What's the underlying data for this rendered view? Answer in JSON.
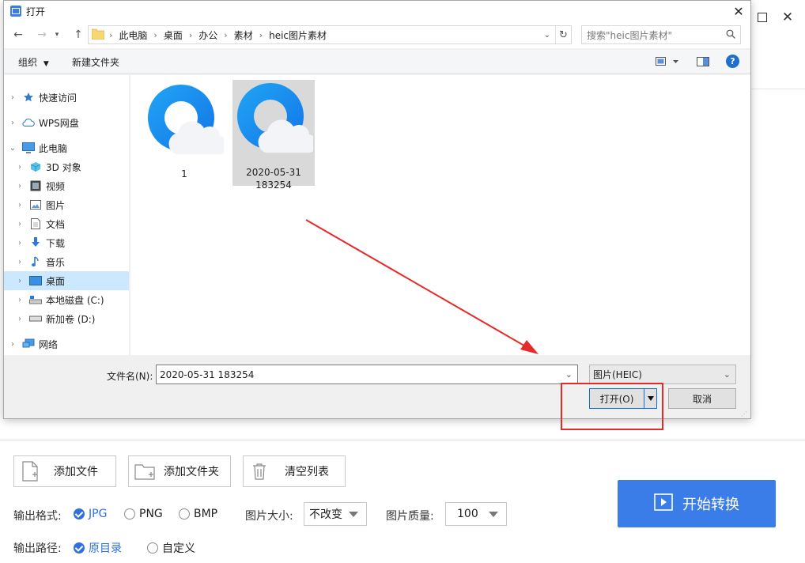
{
  "dialog": {
    "title": "打开",
    "breadcrumbs": [
      "此电脑",
      "桌面",
      "办公",
      "素材",
      "heic图片素材"
    ],
    "search_placeholder": "搜索\"heic图片素材\"",
    "toolbar": {
      "organize": "组织",
      "new_folder": "新建文件夹"
    },
    "nav": [
      {
        "label": "快速访问",
        "icon": "star-icon"
      },
      {
        "label": "WPS网盘",
        "icon": "cloud-icon"
      },
      {
        "label": "此电脑",
        "icon": "computer-icon"
      },
      {
        "label": "3D 对象",
        "icon": "cube-icon"
      },
      {
        "label": "视频",
        "icon": "film-icon"
      },
      {
        "label": "图片",
        "icon": "image-icon"
      },
      {
        "label": "文档",
        "icon": "document-icon"
      },
      {
        "label": "下载",
        "icon": "download-icon"
      },
      {
        "label": "音乐",
        "icon": "music-icon"
      },
      {
        "label": "桌面",
        "icon": "desktop-icon"
      },
      {
        "label": "本地磁盘 (C:)",
        "icon": "disk-icon"
      },
      {
        "label": "新加卷 (D:)",
        "icon": "drive-icon"
      },
      {
        "label": "网络",
        "icon": "network-icon"
      }
    ],
    "files": [
      {
        "name": "1"
      },
      {
        "name": "2020-05-31 183254"
      }
    ],
    "filename_label": "文件名(N):",
    "filename_value": "2020-05-31 183254",
    "filetype": "图片(HEIC)",
    "open_label": "打开(O)",
    "cancel_label": "取消"
  },
  "app": {
    "add_file": "添加文件",
    "add_folder": "添加文件夹",
    "clear_list": "清空列表",
    "format_label": "输出格式:",
    "formats": [
      "JPG",
      "PNG",
      "BMP"
    ],
    "selected_format": "JPG",
    "size_label": "图片大小:",
    "size_value": "不改变",
    "quality_label": "图片质量:",
    "quality_value": "100",
    "path_label": "输出路径:",
    "path_options": [
      "原目录",
      "自定义"
    ],
    "selected_path": "原目录",
    "start_label": "开始转换"
  },
  "colors": {
    "accent": "#3b7de8",
    "annotation": "#e8292a",
    "selection": "#cce8ff"
  }
}
